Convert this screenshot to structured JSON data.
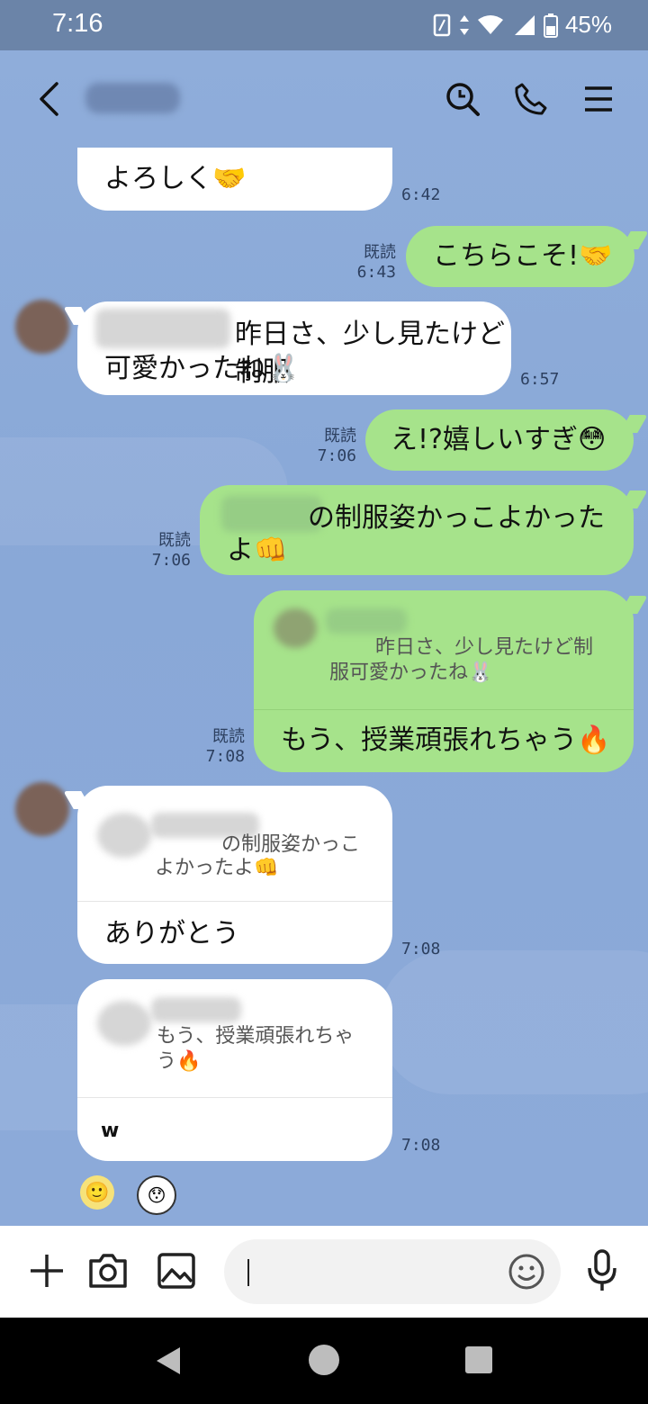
{
  "status_bar": {
    "time": "7:16",
    "battery": "45%"
  },
  "header": {
    "back_icon": "back-icon",
    "search_icon": "search-icon",
    "call_icon": "phone-icon",
    "menu_icon": "menu-icon"
  },
  "messages": [
    {
      "id": "m1",
      "dir": "in",
      "text": "よろしく🤝",
      "time": "6:42"
    },
    {
      "id": "m2",
      "dir": "out",
      "text": "こちらこそ!🤝",
      "read": "既読",
      "time": "6:43"
    },
    {
      "id": "m3",
      "dir": "in",
      "text_line1": "昨日さ、少し見たけど制服",
      "text_line2": "可愛かったね🐰",
      "time": "6:57"
    },
    {
      "id": "m4",
      "dir": "out",
      "text": "え!?嬉しいすぎ😳",
      "read": "既読",
      "time": "7:06"
    },
    {
      "id": "m5",
      "dir": "out",
      "text_line1": "の制服姿かっこよかった",
      "text_line2": "よ👊",
      "read": "既読",
      "time": "7:06"
    },
    {
      "id": "m6",
      "dir": "out",
      "quote_line1": "昨日さ、少し見たけど制",
      "quote_line2": "服可愛かったね🐰",
      "text": "もう、授業頑張れちゃう🔥",
      "read": "既読",
      "time": "7:08"
    },
    {
      "id": "m7",
      "dir": "in",
      "quote_line1": "の制服姿かっこ",
      "quote_line2": "よかったよ👊",
      "text": "ありがとう",
      "time": "7:08"
    },
    {
      "id": "m8",
      "dir": "in",
      "quote_line1": "もう、授業頑張れちゃ",
      "quote_line2": "う🔥",
      "text": "w",
      "time": "7:08"
    }
  ],
  "reactions": {
    "smile": "🙂",
    "sticker": "😯"
  },
  "composer": {
    "placeholder": ""
  },
  "colors": {
    "chat_bg": "#8eacd9",
    "outgoing": "#a6e38b",
    "incoming": "#ffffff"
  }
}
